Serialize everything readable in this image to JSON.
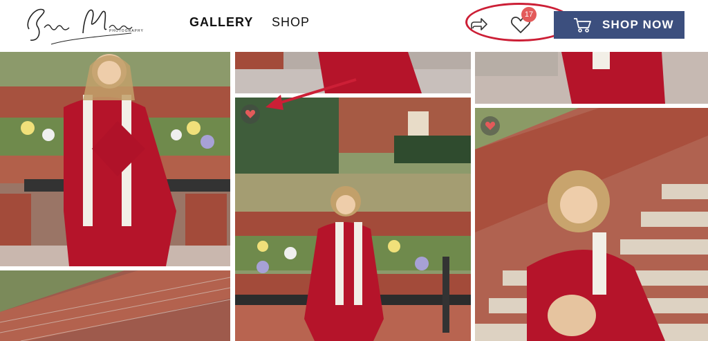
{
  "header": {
    "logo_text": "Season Moore",
    "logo_sub": "PHOTOGRAPHY",
    "nav": [
      {
        "label": "GALLERY",
        "active": true
      },
      {
        "label": "SHOP",
        "active": false
      }
    ],
    "favorites_count": "17",
    "shop_now_label": "SHOP NOW"
  },
  "colors": {
    "accent": "#3c4f7e",
    "badge": "#e35a5a",
    "annotation": "#cc1f36"
  },
  "icons": [
    "share-icon",
    "heart-icon",
    "cart-icon",
    "heart-favorite-icon"
  ]
}
